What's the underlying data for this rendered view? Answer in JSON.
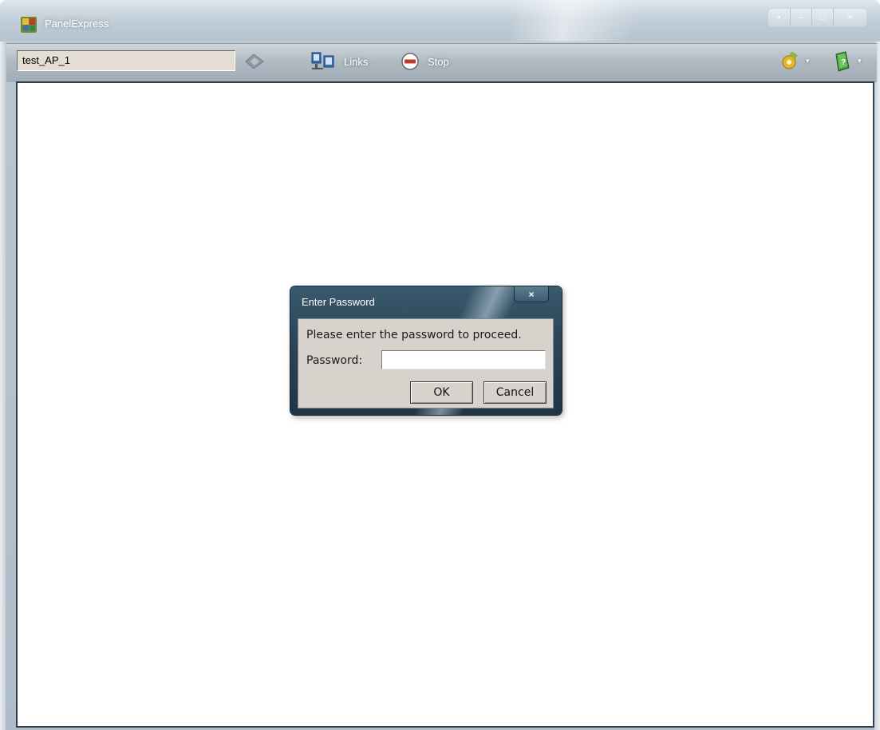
{
  "window": {
    "title": "PanelExpress",
    "caption_buttons": [
      "•",
      "–",
      "□",
      "×"
    ]
  },
  "toolbar": {
    "address_value": "test_AP_1",
    "links_label": "Links",
    "stop_label": "Stop",
    "tools_dropdown_arrow": "▾",
    "help_dropdown_arrow": "▾",
    "icons": [
      "go-arrow-icon",
      "links-icon",
      "stop-icon",
      "tools-icon",
      "help-book-icon"
    ]
  },
  "dialog": {
    "title": "Enter Password",
    "close_label": "×",
    "message": "Please enter the password to proceed.",
    "password_label": "Password:",
    "password_value": "",
    "ok_label": "OK",
    "cancel_label": "Cancel"
  },
  "colors": {
    "dialog_title_bg": "#2c4658",
    "dialog_body_bg": "#d7d3cc",
    "address_bg": "#e3ddd3"
  }
}
